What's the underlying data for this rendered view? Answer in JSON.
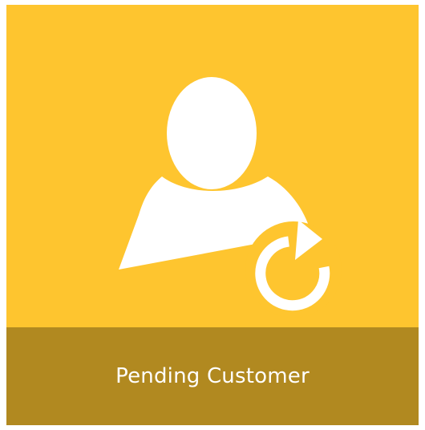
{
  "tile": {
    "label": "Pending Customer",
    "icon": "pending-customer-icon"
  },
  "colors": {
    "tile_background": "#fec52f",
    "caption_background": "#b18920",
    "icon_fill": "#ffffff",
    "caption_text": "#ffffff"
  }
}
